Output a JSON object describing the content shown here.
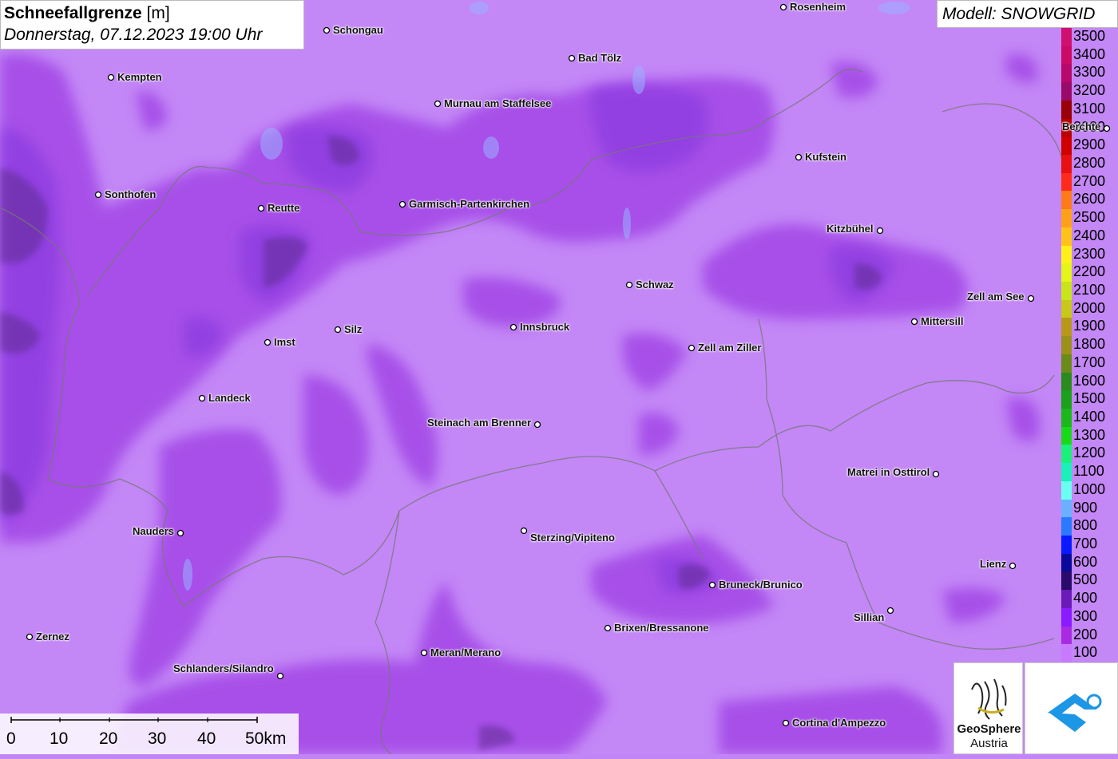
{
  "title": {
    "main_bold": "Schneefallgrenze",
    "main_unit": "[m]",
    "date": "Donnerstag, 07.12.2023 19:00 Uhr"
  },
  "model": "Modell: SNOWGRID",
  "legend": [
    {
      "label": "3500",
      "color": "#d0106e"
    },
    {
      "label": "3400",
      "color": "#cc0a66"
    },
    {
      "label": "3300",
      "color": "#b8086a"
    },
    {
      "label": "3200",
      "color": "#9a0a68"
    },
    {
      "label": "3100",
      "color": "#9a0008"
    },
    {
      "label": "3000",
      "color": "#b80000"
    },
    {
      "label": "2900",
      "color": "#d00000"
    },
    {
      "label": "2800",
      "color": "#e81010"
    },
    {
      "label": "2700",
      "color": "#ff2a1a"
    },
    {
      "label": "2600",
      "color": "#ff7a1a"
    },
    {
      "label": "2500",
      "color": "#ffa01a"
    },
    {
      "label": "2400",
      "color": "#ffc21a"
    },
    {
      "label": "2300",
      "color": "#fff01a"
    },
    {
      "label": "2200",
      "color": "#e4f51a"
    },
    {
      "label": "2100",
      "color": "#c8e41a"
    },
    {
      "label": "2000",
      "color": "#c8c81a"
    },
    {
      "label": "1900",
      "color": "#b8981a"
    },
    {
      "label": "1800",
      "color": "#9a901a"
    },
    {
      "label": "1700",
      "color": "#6a8a1a"
    },
    {
      "label": "1600",
      "color": "#2a8a1a"
    },
    {
      "label": "1500",
      "color": "#1aa01a"
    },
    {
      "label": "1400",
      "color": "#1ab81a"
    },
    {
      "label": "1300",
      "color": "#1ad81a"
    },
    {
      "label": "1200",
      "color": "#1af07a"
    },
    {
      "label": "1100",
      "color": "#1af0b8"
    },
    {
      "label": "1000",
      "color": "#6afff0"
    },
    {
      "label": "900",
      "color": "#6ab0ff"
    },
    {
      "label": "800",
      "color": "#2a7aff"
    },
    {
      "label": "700",
      "color": "#0a1aff"
    },
    {
      "label": "600",
      "color": "#0a0a9a"
    },
    {
      "label": "500",
      "color": "#2a0a6a"
    },
    {
      "label": "400",
      "color": "#6a1ab8"
    },
    {
      "label": "300",
      "color": "#8a1aff"
    },
    {
      "label": "200",
      "color": "#aa2ae4"
    },
    {
      "label": "100",
      "color": "#c87aff"
    }
  ],
  "cities": [
    {
      "name": "Rosenheim"
    },
    {
      "name": "Schongau"
    },
    {
      "name": "Kempten"
    },
    {
      "name": "Bad Tölz"
    },
    {
      "name": "Murnau am Staffelsee"
    },
    {
      "name": "Berchte"
    },
    {
      "name": "Kufstein"
    },
    {
      "name": "Sonthofen"
    },
    {
      "name": "Reutte"
    },
    {
      "name": "Garmisch-Partenkirchen"
    },
    {
      "name": "Kitzbühel"
    },
    {
      "name": "Schwaz"
    },
    {
      "name": "Zell am See"
    },
    {
      "name": "Innsbruck"
    },
    {
      "name": "Silz"
    },
    {
      "name": "Mittersill"
    },
    {
      "name": "Imst"
    },
    {
      "name": "Zell am Ziller"
    },
    {
      "name": "Landeck"
    },
    {
      "name": "Steinach am Brenner"
    },
    {
      "name": "Matrei in Osttirol"
    },
    {
      "name": "Nauders"
    },
    {
      "name": "Sterzing/Vipiteno"
    },
    {
      "name": "Lienz"
    },
    {
      "name": "Bruneck/Brunico"
    },
    {
      "name": "Sillian"
    },
    {
      "name": "Brixen/Bressanone"
    },
    {
      "name": "Zernez"
    },
    {
      "name": "Meran/Merano"
    },
    {
      "name": "Schlanders/Silandro"
    },
    {
      "name": "Cortina d'Ampezzo"
    }
  ],
  "scale": {
    "labels": [
      "0",
      "10",
      "20",
      "30",
      "40",
      "50km"
    ]
  },
  "logo": {
    "text_top": "GeoSphere",
    "text_bottom": "Austria"
  }
}
